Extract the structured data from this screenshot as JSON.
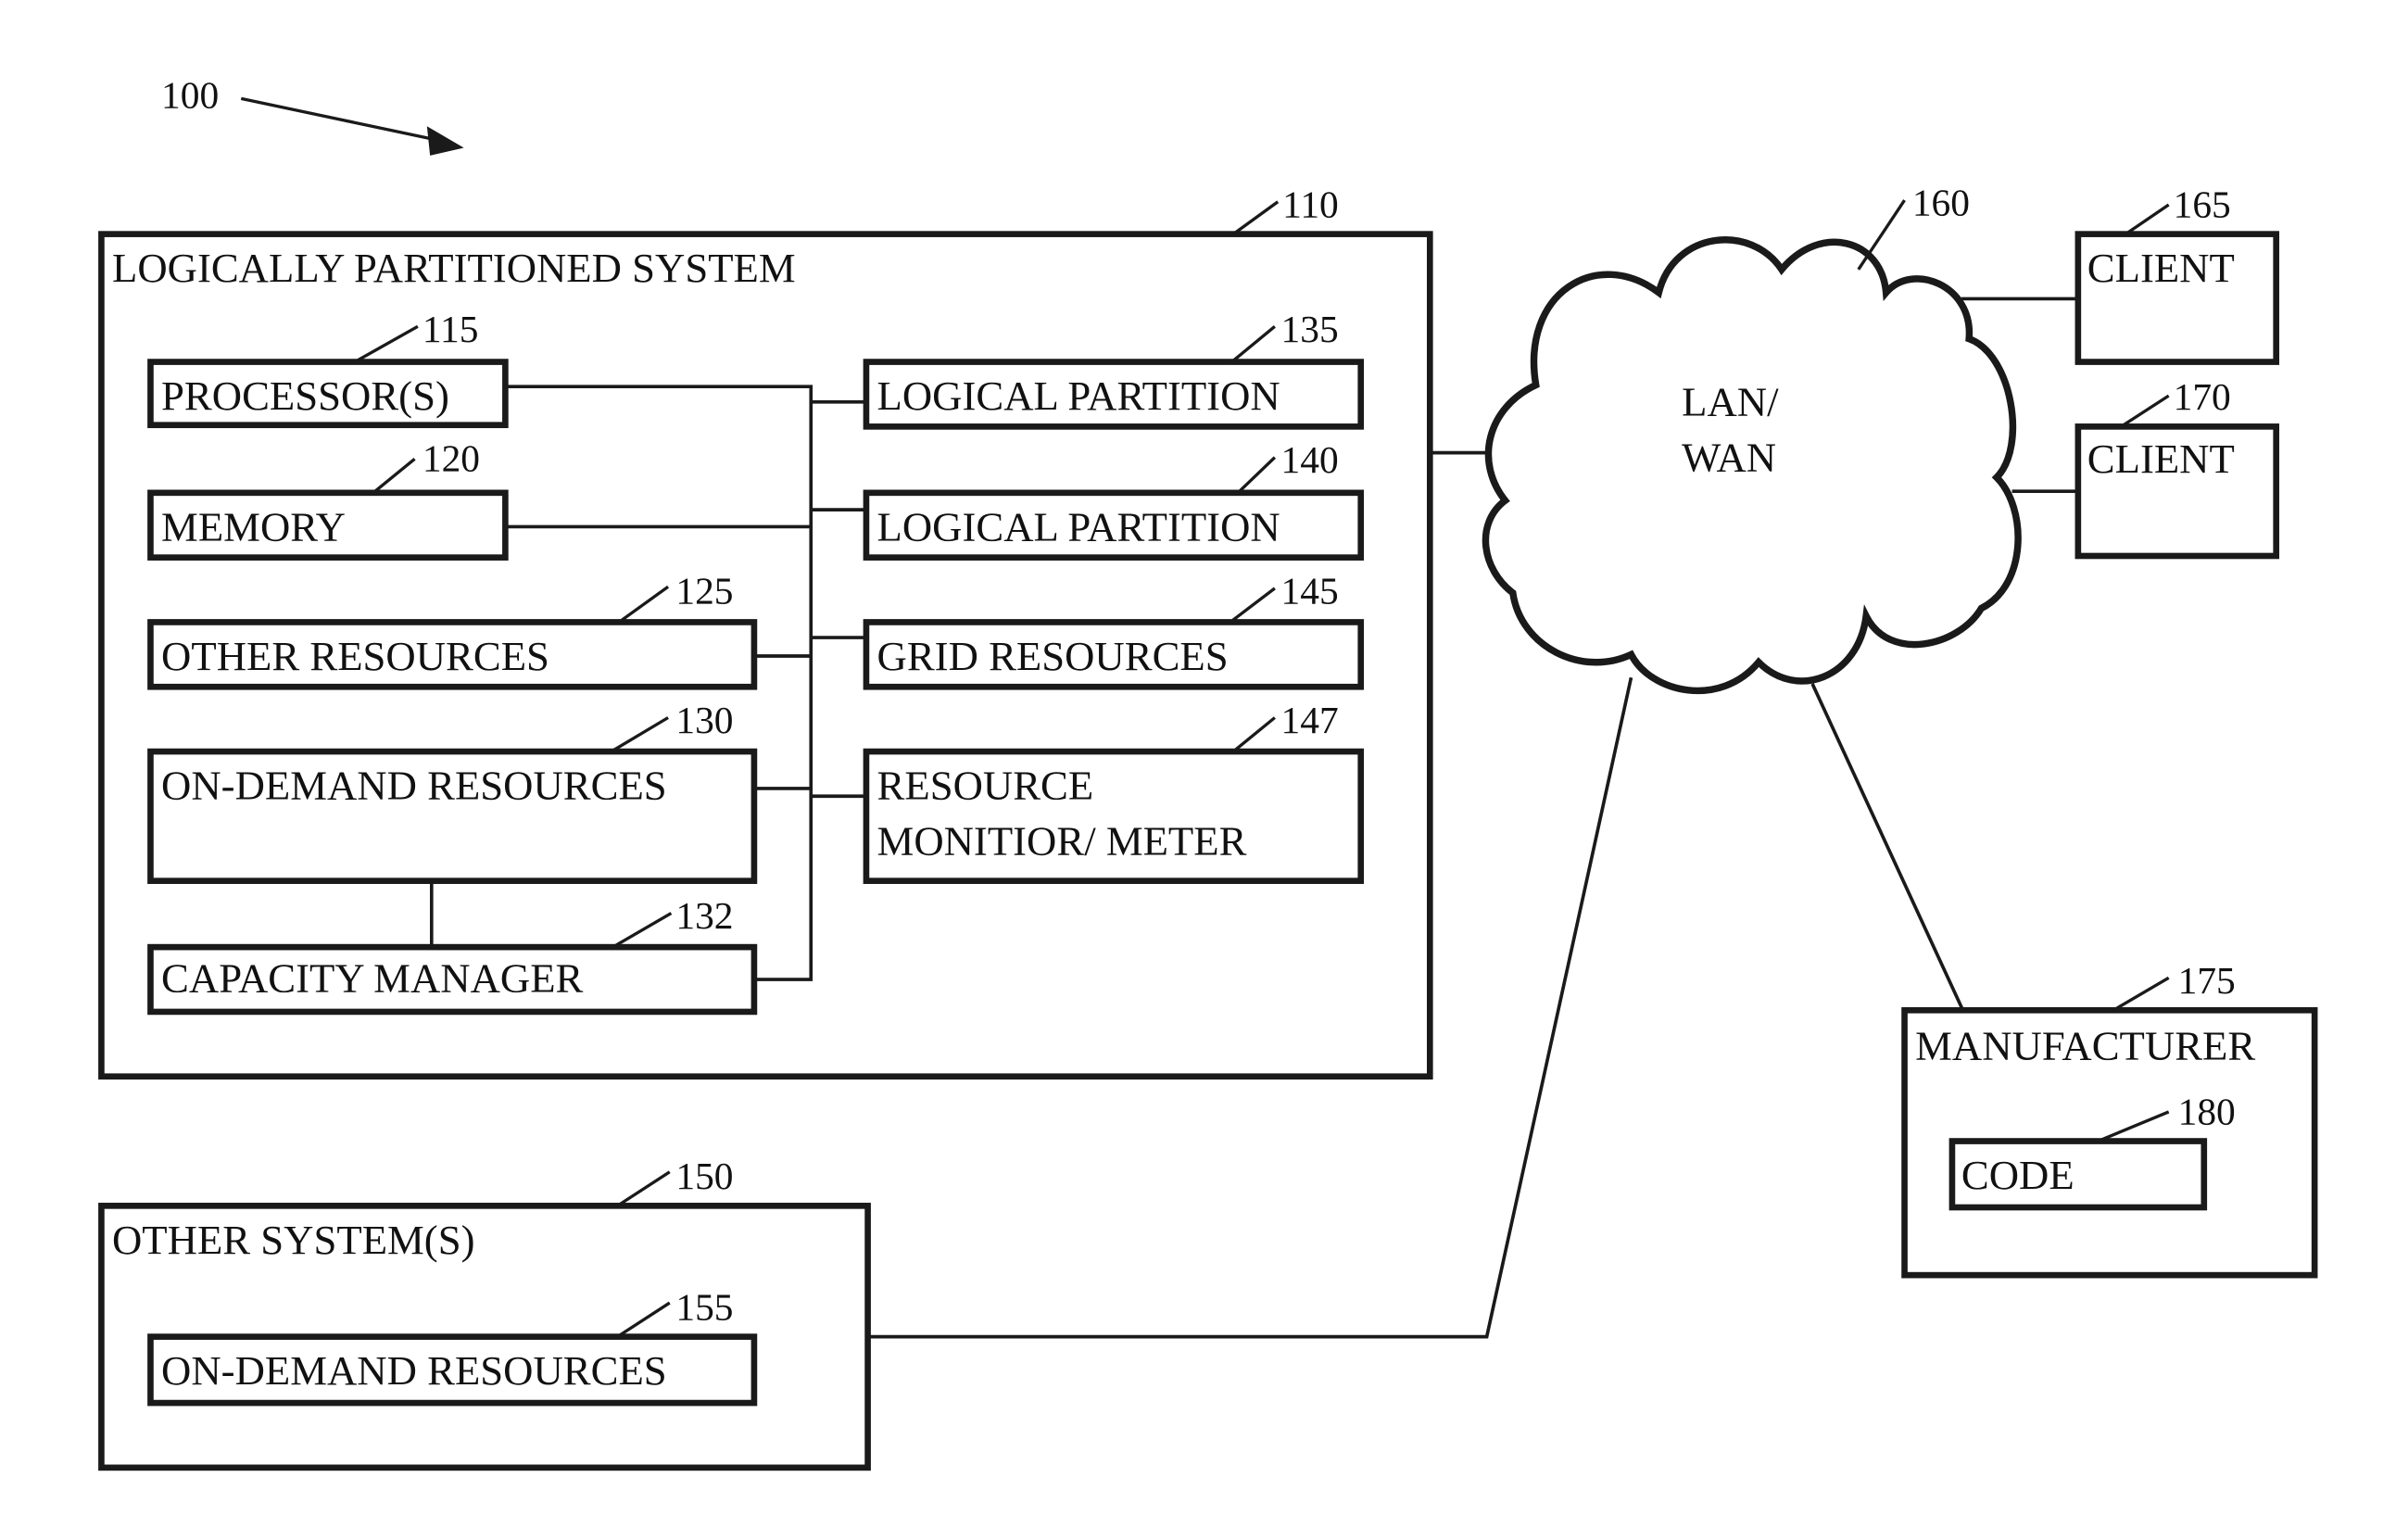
{
  "figure": {
    "ref": "100",
    "nodes": {
      "lps": {
        "label": "LOGICALLY PARTITIONED SYSTEM",
        "ref": "110"
      },
      "processors": {
        "label": "PROCESSOR(S)",
        "ref": "115"
      },
      "memory": {
        "label": "MEMORY",
        "ref": "120"
      },
      "other_resources": {
        "label": "OTHER RESOURCES",
        "ref": "125"
      },
      "on_demand": {
        "label": "ON-DEMAND RESOURCES",
        "ref": "130"
      },
      "capacity_manager": {
        "label": "CAPACITY MANAGER",
        "ref": "132"
      },
      "lpar1": {
        "label": "LOGICAL PARTITION",
        "ref": "135"
      },
      "lpar2": {
        "label": "LOGICAL PARTITION",
        "ref": "140"
      },
      "grid": {
        "label": "GRID RESOURCES",
        "ref": "145"
      },
      "monitor": {
        "label_line1": "RESOURCE",
        "label_line2": "MONITIOR/ METER",
        "ref": "147"
      },
      "other_systems": {
        "label": "OTHER SYSTEM(S)",
        "ref": "150"
      },
      "other_on_demand": {
        "label": "ON-DEMAND RESOURCES",
        "ref": "155"
      },
      "network": {
        "label_line1": "LAN/",
        "label_line2": "WAN",
        "ref": "160"
      },
      "client1": {
        "label": "CLIENT",
        "ref": "165"
      },
      "client2": {
        "label": "CLIENT",
        "ref": "170"
      },
      "manufacturer": {
        "label": "MANUFACTURER",
        "ref": "175"
      },
      "code": {
        "label": "CODE",
        "ref": "180"
      }
    }
  }
}
